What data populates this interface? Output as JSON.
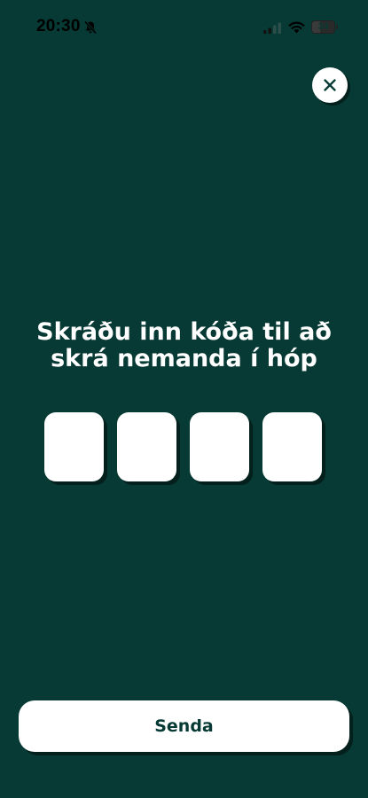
{
  "status_bar": {
    "time": "20:30",
    "battery": "34",
    "icons": [
      "bell-slash-icon",
      "signal-icon",
      "wifi-icon",
      "battery-icon"
    ]
  },
  "colors": {
    "background": "#073a34",
    "surface": "#ffffff",
    "shadow": "#03201d",
    "text_dark": "#073a34"
  },
  "header": {
    "close_icon": "close-icon"
  },
  "main": {
    "title_line1": "Skráðu inn kóða til að",
    "title_line2": "skrá nemanda í hóp",
    "code_inputs": [
      "",
      "",
      "",
      ""
    ]
  },
  "footer": {
    "send_label": "Senda"
  }
}
